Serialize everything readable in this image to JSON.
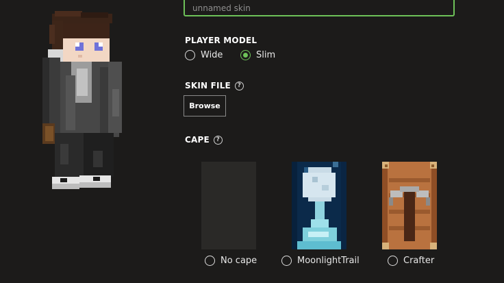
{
  "skin_name": {
    "placeholder": "unnamed skin"
  },
  "player_model": {
    "title": "PLAYER MODEL",
    "options": [
      {
        "label": "Wide",
        "selected": false
      },
      {
        "label": "Slim",
        "selected": true
      }
    ]
  },
  "skin_file": {
    "title": "SKIN FILE",
    "help": "?",
    "button_label": "Browse"
  },
  "cape": {
    "title": "CAPE",
    "help": "?",
    "options": [
      {
        "label": "No cape",
        "selected": false
      },
      {
        "label": "MoonlightTrail",
        "selected": false
      },
      {
        "label": "Crafter",
        "selected": false
      }
    ]
  },
  "colors": {
    "accent": "#6ec259",
    "background": "#1c1b1a"
  }
}
